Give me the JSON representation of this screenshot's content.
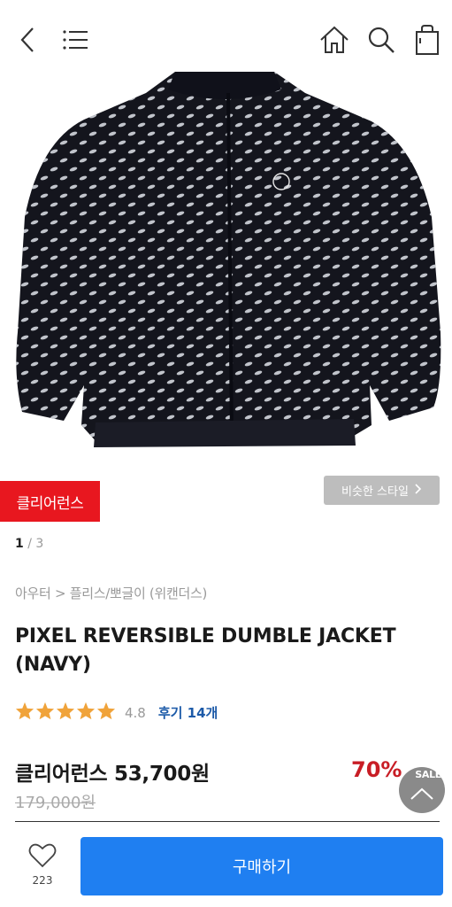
{
  "header": {
    "icons": [
      "back-icon",
      "menu-icon",
      "home-icon",
      "search-icon",
      "cart-icon"
    ]
  },
  "gallery": {
    "badge": "클리어런스",
    "similar_style": "비슷한 스타일",
    "current": "1",
    "separator": "/",
    "total": "3"
  },
  "product": {
    "breadcrumb": "아우터 > 플리스/뽀글이 (위캔더스)",
    "title": "PIXEL REVERSIBLE DUMBLE JACKET (NAVY)",
    "rating": "4.8",
    "review_label": "후기 14개",
    "stars": 5,
    "price_text": "클리어런스 53,700원",
    "original_price": "179,000원",
    "discount": "70%"
  },
  "floating": {
    "label": "SALE"
  },
  "bottom": {
    "wish_count": "223",
    "buy_label": "구매하기"
  },
  "colors": {
    "accent": "#1f7ff1",
    "badge": "#e8171f",
    "discount": "#c81d25",
    "star": "#f0a33a",
    "review": "#1c5aa8"
  }
}
